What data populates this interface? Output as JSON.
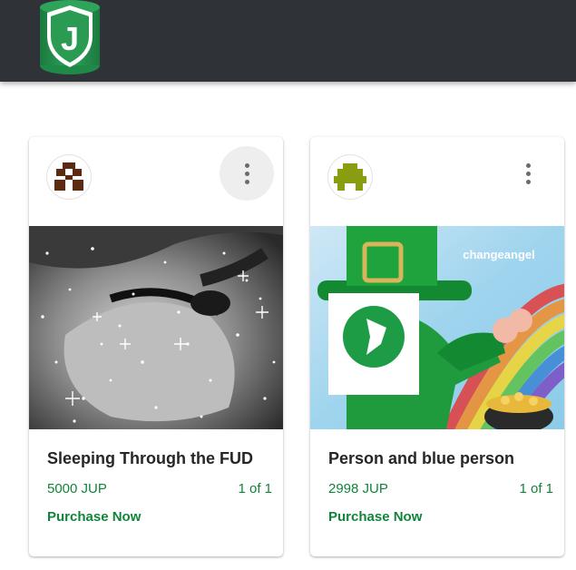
{
  "header": {
    "logo_letter": "J"
  },
  "cards": [
    {
      "title": "Sleeping Through the FUD",
      "price": "5000 JUP",
      "edition": "1 of 1",
      "purchase_label": "Purchase Now",
      "menu_icon": "more-vert-icon"
    },
    {
      "title": "Person and blue person",
      "price": "2998 JUP",
      "edition": "1 of 1",
      "purchase_label": "Purchase Now",
      "menu_icon": "more-vert-icon",
      "image_text": "changeangel"
    }
  ],
  "colors": {
    "header_bg": "#2f3338",
    "accent_green": "#12843a",
    "logo_green": "#1f8a47"
  }
}
